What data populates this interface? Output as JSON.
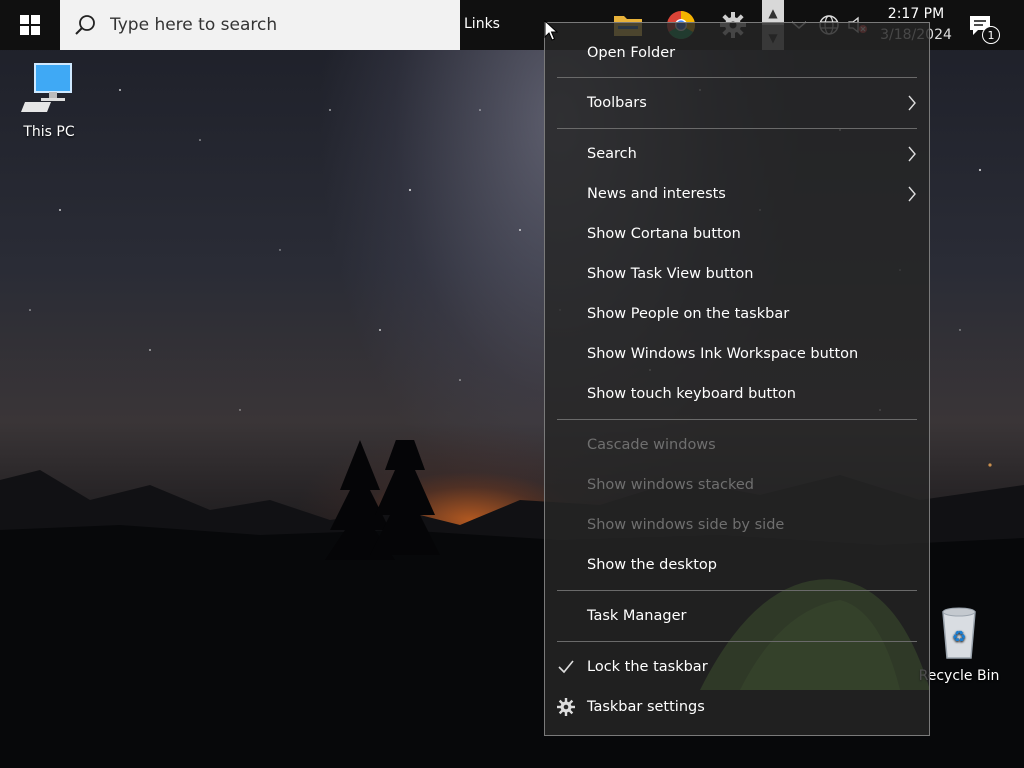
{
  "taskbar": {
    "search_placeholder": "Type here to search",
    "links_label": "Links",
    "clock_time": "2:17 PM",
    "clock_date": "3/18/2024",
    "notification_count": "1"
  },
  "desktop": {
    "icons": [
      {
        "label": "This PC"
      },
      {
        "label": "Recycle Bin"
      }
    ]
  },
  "context_menu": {
    "items": [
      {
        "label": "Open Folder"
      },
      {
        "label": "Toolbars"
      },
      {
        "label": "Search"
      },
      {
        "label": "News and interests"
      },
      {
        "label": "Show Cortana button"
      },
      {
        "label": "Show Task View button"
      },
      {
        "label": "Show People on the taskbar"
      },
      {
        "label": "Show Windows Ink Workspace button"
      },
      {
        "label": "Show touch keyboard button"
      },
      {
        "label": "Cascade windows"
      },
      {
        "label": "Show windows stacked"
      },
      {
        "label": "Show windows side by side"
      },
      {
        "label": "Show the desktop"
      },
      {
        "label": "Task Manager"
      },
      {
        "label": "Lock the taskbar"
      },
      {
        "label": "Taskbar settings"
      }
    ]
  },
  "colors": {
    "taskbar_bg": "#101010",
    "menu_bg": "#262626",
    "menu_disabled_text": "#6f6f6f",
    "tent_green": "#6fb23a"
  }
}
